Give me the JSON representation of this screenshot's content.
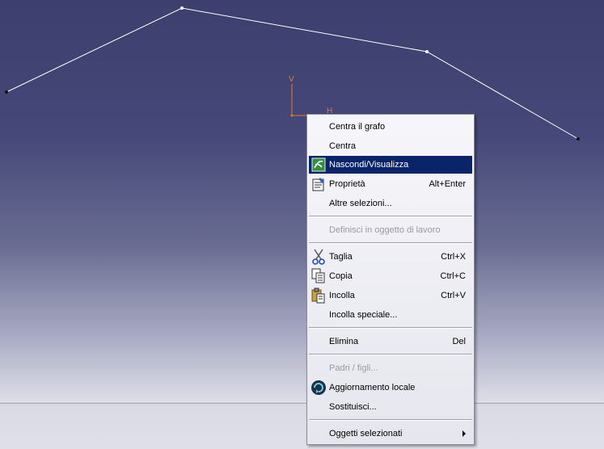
{
  "axis": {
    "vertical_label": "V",
    "horizontal_label": "H",
    "color": "#e07a2a"
  },
  "colors": {
    "highlight": "#0a246a",
    "polyline": "#ffffff"
  },
  "menu": {
    "items": [
      {
        "label": "Centra il grafo",
        "shortcut": "",
        "icon": "",
        "state": "normal"
      },
      {
        "label": "Centra",
        "shortcut": "",
        "icon": "",
        "state": "normal"
      },
      {
        "label": "Nascondi/Visualizza",
        "shortcut": "",
        "icon": "hide-show-icon",
        "state": "highlighted"
      },
      {
        "label": "Proprietà",
        "shortcut": "Alt+Enter",
        "icon": "properties-icon",
        "state": "normal"
      },
      {
        "label": "Altre selezioni...",
        "shortcut": "",
        "icon": "",
        "state": "normal"
      },
      {
        "label": "Definisci in oggetto di lavoro",
        "shortcut": "",
        "icon": "",
        "state": "disabled"
      },
      {
        "label": "Taglia",
        "shortcut": "Ctrl+X",
        "icon": "scissors-icon",
        "state": "normal"
      },
      {
        "label": "Copia",
        "shortcut": "Ctrl+C",
        "icon": "copy-icon",
        "state": "normal"
      },
      {
        "label": "Incolla",
        "shortcut": "Ctrl+V",
        "icon": "paste-icon",
        "state": "normal"
      },
      {
        "label": "Incolla speciale...",
        "shortcut": "",
        "icon": "",
        "state": "normal"
      },
      {
        "label": "Elimina",
        "shortcut": "Del",
        "icon": "",
        "state": "normal"
      },
      {
        "label": "Padri / figli...",
        "shortcut": "",
        "icon": "",
        "state": "disabled"
      },
      {
        "label": "Aggiornamento locale",
        "shortcut": "",
        "icon": "local-update-icon",
        "state": "normal"
      },
      {
        "label": "Sostituisci...",
        "shortcut": "",
        "icon": "",
        "state": "normal"
      },
      {
        "label": "Oggetti selezionati",
        "shortcut": "",
        "icon": "submenu-arrow-icon",
        "state": "normal"
      }
    ]
  }
}
